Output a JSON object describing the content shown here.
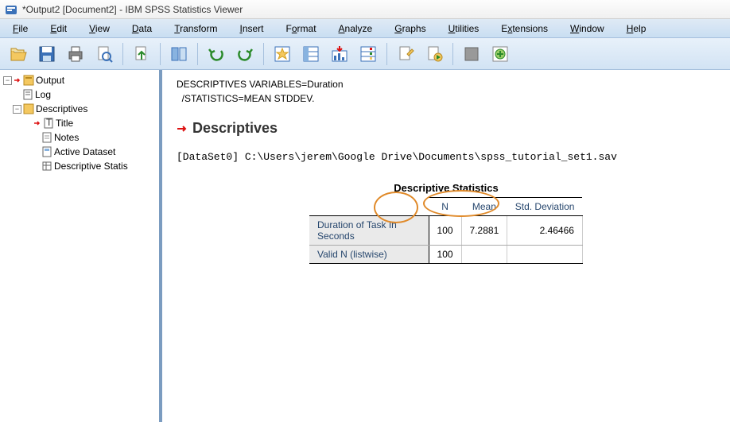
{
  "title": "*Output2 [Document2] - IBM SPSS Statistics Viewer",
  "menu": [
    "File",
    "Edit",
    "View",
    "Data",
    "Transform",
    "Insert",
    "Format",
    "Analyze",
    "Graphs",
    "Utilities",
    "Extensions",
    "Window",
    "Help"
  ],
  "menu_underlines": [
    0,
    0,
    0,
    0,
    0,
    0,
    1,
    0,
    0,
    0,
    1,
    0,
    0
  ],
  "toolbar_icons": [
    "open",
    "save",
    "print",
    "preview",
    "",
    "export",
    "",
    "panes",
    "",
    "undo",
    "redo",
    "",
    "star-chart",
    "grid-left",
    "chart-down",
    "grid-opts",
    "",
    "page-edit",
    "page-play",
    "",
    "box",
    "plus"
  ],
  "tree": {
    "root": {
      "label": "Output",
      "icon": "output"
    },
    "children": [
      {
        "label": "Log",
        "icon": "log"
      },
      {
        "label": "Descriptives",
        "icon": "folder",
        "expanded": true,
        "children": [
          {
            "label": "Title",
            "icon": "title",
            "current": true
          },
          {
            "label": "Notes",
            "icon": "notes"
          },
          {
            "label": "Active Dataset",
            "icon": "dataset"
          },
          {
            "label": "Descriptive Statis",
            "icon": "table"
          }
        ]
      }
    ]
  },
  "syntax_line1": "DESCRIPTIVES VARIABLES=Duration",
  "syntax_line2": "  /STATISTICS=MEAN STDDEV.",
  "section_heading": "Descriptives",
  "dataset_line": "[DataSet0] C:\\Users\\jerem\\Google Drive\\Documents\\spss_tutorial_set1.sav",
  "table_title": "Descriptive Statistics",
  "columns": [
    "",
    "N",
    "Mean",
    "Std. Deviation"
  ],
  "rows": [
    {
      "label": "Duration of Task In Seconds",
      "n": "100",
      "mean": "7.2881",
      "sd": "2.46466"
    },
    {
      "label": "Valid N (listwise)",
      "n": "100",
      "mean": "",
      "sd": ""
    }
  ],
  "chart_data": {
    "type": "table",
    "title": "Descriptive Statistics",
    "columns": [
      "N",
      "Mean",
      "Std. Deviation"
    ],
    "rows": [
      {
        "variable": "Duration of Task In Seconds",
        "N": 100,
        "Mean": 7.2881,
        "Std. Deviation": 2.46466
      },
      {
        "variable": "Valid N (listwise)",
        "N": 100,
        "Mean": null,
        "Std. Deviation": null
      }
    ]
  }
}
